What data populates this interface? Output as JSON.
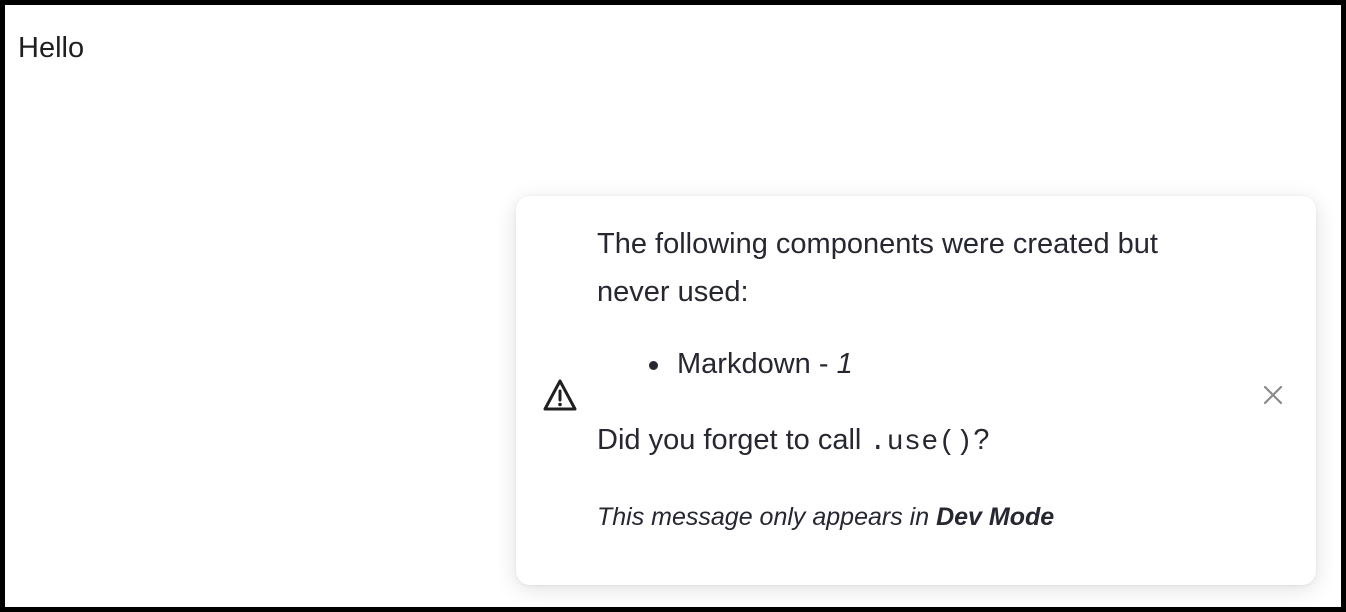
{
  "page": {
    "text": "Hello"
  },
  "toast": {
    "line1": "The following components were created but",
    "line2": "never used:",
    "items": [
      {
        "name": "Markdown",
        "separator": " - ",
        "count": "1"
      }
    ],
    "question_prefix": "Did you forget to call ",
    "question_code": ".use()",
    "question_suffix": "?",
    "note_prefix": "This message only appears in ",
    "note_bold": "Dev Mode",
    "icons": {
      "status": "warning-icon",
      "dismiss": "close-icon"
    }
  },
  "colors": {
    "background": "#ffffff",
    "frame": "#000000",
    "text": "#262730",
    "close_icon": "#8a8a8a"
  }
}
